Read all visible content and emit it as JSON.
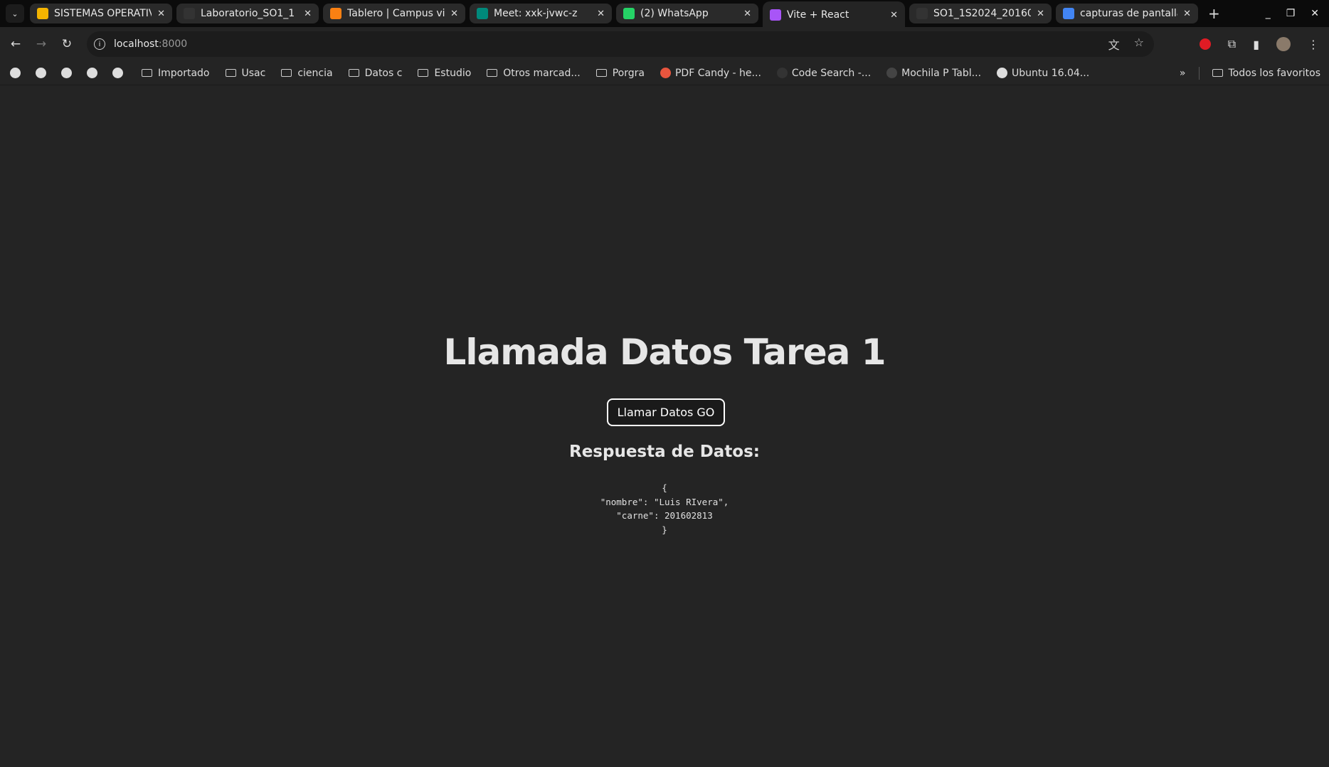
{
  "tabs": [
    {
      "title": "SISTEMAS OPERATIV",
      "icon": "classroom-icon",
      "color": "#f4b400",
      "active": false
    },
    {
      "title": "Laboratorio_SO1_1",
      "icon": "github-icon",
      "color": "#333333",
      "active": false
    },
    {
      "title": "Tablero | Campus vi",
      "icon": "moodle-icon",
      "color": "#f98012",
      "active": false
    },
    {
      "title": "Meet: xxk-jvwc-z",
      "icon": "meet-icon",
      "color": "#00897b",
      "active": false
    },
    {
      "title": "(2) WhatsApp",
      "icon": "whatsapp-icon",
      "color": "#25d366",
      "active": false
    },
    {
      "title": "Vite + React",
      "icon": "vite-icon",
      "color": "#a855f7",
      "active": true
    },
    {
      "title": "SO1_1S2024_20160",
      "icon": "github-icon",
      "color": "#333333",
      "active": false
    },
    {
      "title": "capturas de pantalla",
      "icon": "google-icon",
      "color": "#4285f4",
      "active": false
    }
  ],
  "address": {
    "host": "localhost",
    "port": ":8000"
  },
  "bookmarks": [
    {
      "label": "Importado",
      "type": "folder"
    },
    {
      "label": "Usac",
      "type": "folder"
    },
    {
      "label": "ciencia",
      "type": "folder"
    },
    {
      "label": "Datos c",
      "type": "folder"
    },
    {
      "label": "Estudio",
      "type": "folder"
    },
    {
      "label": "Otros marcad...",
      "type": "folder"
    },
    {
      "label": "Porgra",
      "type": "folder"
    },
    {
      "label": "PDF Candy - he...",
      "type": "site",
      "color": "#e8553e"
    },
    {
      "label": "Code Search -...",
      "type": "site",
      "color": "#333333"
    },
    {
      "label": "Mochila P Tabl...",
      "type": "site",
      "color": "#444444"
    },
    {
      "label": "Ubuntu 16.04...",
      "type": "site",
      "color": "#dddddd"
    }
  ],
  "all_bookmarks": "Todos los favoritos",
  "page": {
    "title": "Llamada Datos Tarea 1",
    "button": "Llamar Datos GO",
    "response_heading": "Respuesta de Datos:",
    "response_json": "{\n\"nombre\": \"Luis RIvera\",\n\"carne\": 201602813\n}"
  }
}
